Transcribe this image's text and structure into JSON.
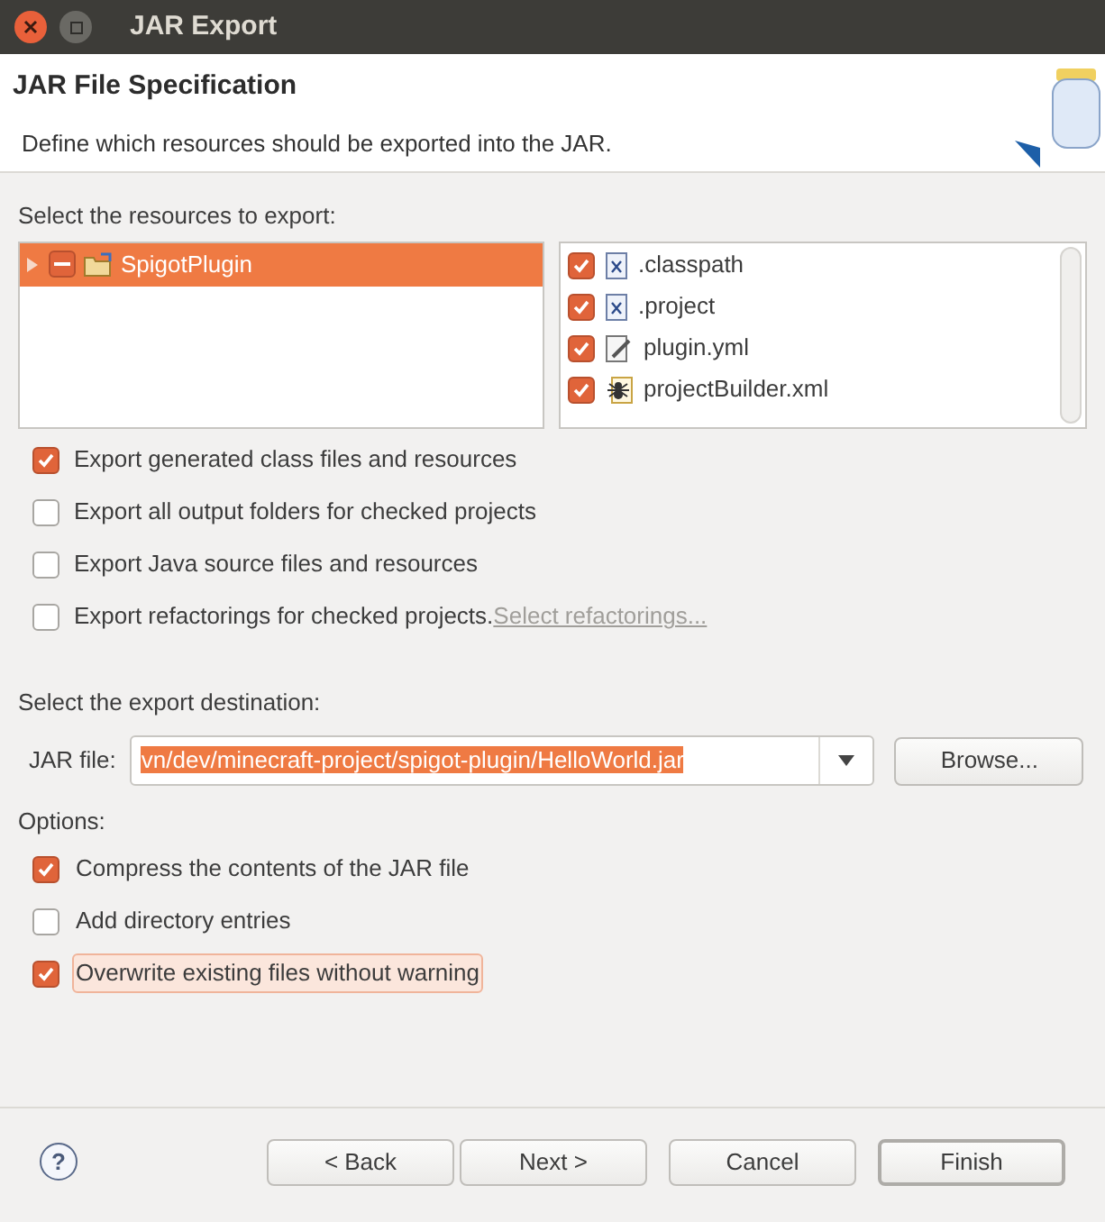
{
  "window": {
    "title": "JAR Export"
  },
  "header": {
    "title": "JAR File Specification",
    "description": "Define which resources should be exported into the JAR."
  },
  "resources": {
    "label": "Select the resources to export:",
    "tree": [
      {
        "label": "SpigotPlugin",
        "selected": true,
        "expanded": false,
        "checked": true,
        "partial": true
      }
    ],
    "files": [
      {
        "name": ".classpath",
        "checked": true,
        "kind": "xml"
      },
      {
        "name": ".project",
        "checked": true,
        "kind": "xml"
      },
      {
        "name": "plugin.yml",
        "checked": true,
        "kind": "text"
      },
      {
        "name": "projectBuilder.xml",
        "checked": true,
        "kind": "ant"
      }
    ]
  },
  "export_options": [
    {
      "label": "Export generated class files and resources",
      "checked": true
    },
    {
      "label": "Export all output folders for checked projects",
      "checked": false
    },
    {
      "label": "Export Java source files and resources",
      "checked": false
    },
    {
      "label": "Export refactorings for checked projects.",
      "checked": false,
      "link": "Select refactorings..."
    }
  ],
  "destination": {
    "label": "Select the export destination:",
    "field_label": "JAR file:",
    "value": "vn/dev/minecraft-project/spigot-plugin/HelloWorld.jar",
    "browse": "Browse..."
  },
  "options": {
    "label": "Options:",
    "items": [
      {
        "label": "Compress the contents of the JAR file",
        "checked": true,
        "focused": false
      },
      {
        "label": "Add directory entries",
        "checked": false,
        "focused": false
      },
      {
        "label": "Overwrite existing files without warning",
        "checked": true,
        "focused": true
      }
    ]
  },
  "help": "?",
  "buttons": [
    {
      "label": "< Back",
      "default": false
    },
    {
      "label": "Next >",
      "default": false
    },
    {
      "label": "Cancel",
      "default": false
    },
    {
      "label": "Finish",
      "default": true
    }
  ]
}
